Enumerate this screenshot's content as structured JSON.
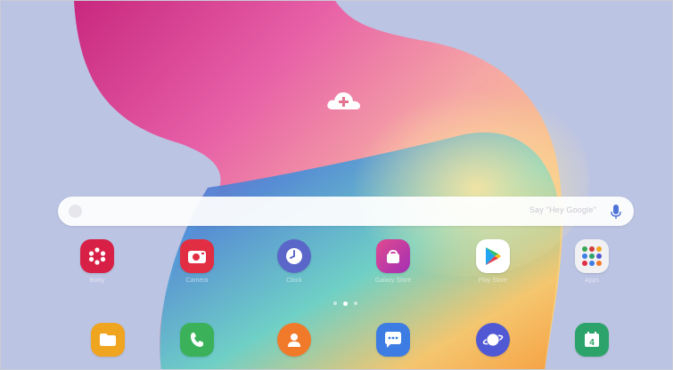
{
  "home_screen": {
    "widget": {
      "icon": "cloud-add-icon"
    },
    "search_bar": {
      "placeholder": "Say \"Hey Google\"",
      "icon": "mic-icon"
    },
    "apps_row_1": [
      {
        "label": "Bixby",
        "icon": "bixby-icon",
        "color": "#d81f45"
      },
      {
        "label": "Camera",
        "icon": "camera-icon",
        "color": "#e22e43"
      },
      {
        "label": "Clock",
        "icon": "clock-icon",
        "color": "#5b66c9"
      },
      {
        "label": "Galaxy Store",
        "icon": "bag-icon",
        "color": "#c62f8c"
      },
      {
        "label": "Play Store",
        "icon": "play-icon",
        "color": "#ffffff"
      },
      {
        "label": "Apps",
        "icon": "folder-icon",
        "color": "#f1f1f4"
      }
    ],
    "apps_row_2": [
      {
        "label": "",
        "icon": "files-icon",
        "color": "#f0a521"
      },
      {
        "label": "",
        "icon": "phone-icon",
        "color": "#3bb25a"
      },
      {
        "label": "",
        "icon": "contacts-icon",
        "color": "#f07a2a"
      },
      {
        "label": "",
        "icon": "messages-icon",
        "color": "#3d7de3"
      },
      {
        "label": "",
        "icon": "internet-icon",
        "color": "#5058d4"
      },
      {
        "label": "",
        "icon": "calendar-icon",
        "color": "#2ca36a",
        "text": "4"
      }
    ],
    "page_indicator": {
      "pages": 3,
      "current": 2
    }
  }
}
